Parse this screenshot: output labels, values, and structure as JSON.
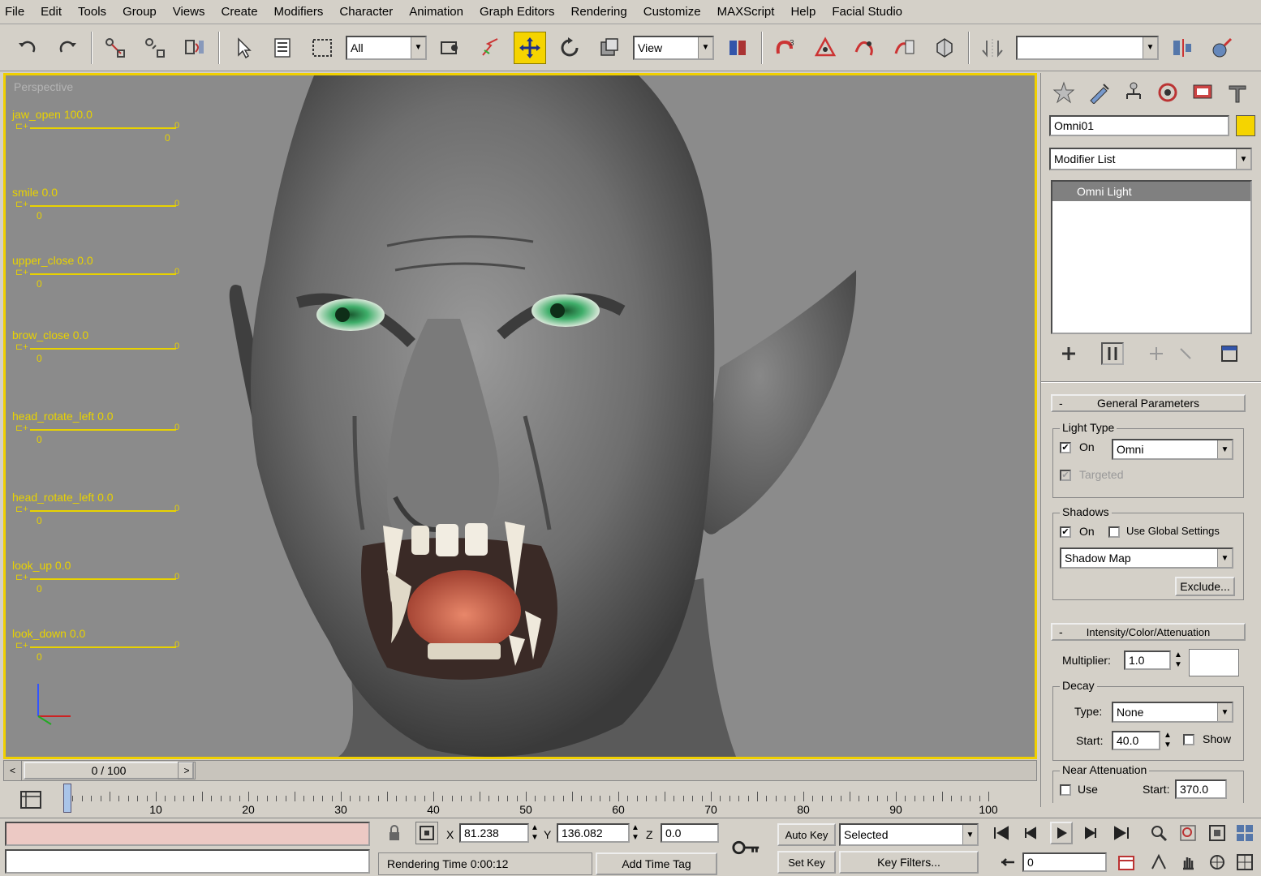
{
  "menu": [
    "File",
    "Edit",
    "Tools",
    "Group",
    "Views",
    "Create",
    "Modifiers",
    "Character",
    "Animation",
    "Graph Editors",
    "Rendering",
    "Customize",
    "MAXScript",
    "Help",
    "Facial Studio"
  ],
  "toolbar": {
    "selection_filter": "All",
    "reference_coord": "View",
    "named_selection": ""
  },
  "viewport": {
    "label": "Perspective",
    "morphs": [
      {
        "name": "jaw_open 100.0",
        "min": "0",
        "max": "0",
        "thumb": "0",
        "value": 1.0
      },
      {
        "name": "smile 0.0",
        "min": "0",
        "max": "0",
        "thumb": "0",
        "value": 0.0
      },
      {
        "name": "upper_close 0.0",
        "min": "0",
        "max": "0",
        "thumb": "0",
        "value": 0.0
      },
      {
        "name": "brow_close 0.0",
        "min": "0",
        "max": "0",
        "thumb": "0",
        "value": 0.0
      },
      {
        "name": "head_rotate_left 0.0",
        "min": "0",
        "max": "0",
        "thumb": "0",
        "value": 0.0
      },
      {
        "name": "head_rotate_left 0.0",
        "min": "0",
        "max": "0",
        "thumb": "0",
        "value": 0.0
      },
      {
        "name": "look_up 0.0",
        "min": "0",
        "max": "0",
        "thumb": "0",
        "value": 0.0
      },
      {
        "name": "look_down 0.0",
        "min": "0",
        "max": "0",
        "thumb": "0",
        "value": 0.0
      }
    ],
    "border_color": "#f0d000",
    "background_color": "#8b8b8b"
  },
  "command_panel": {
    "object_name": "Omni01",
    "object_color": "#f5d400",
    "modifier_list": "Modifier List",
    "stack_item": "Omni Light",
    "general_params": {
      "title": "General Parameters",
      "light_type_group": "Light Type",
      "on_label": "On",
      "on_checked": "✔",
      "light_type": "Omni",
      "targeted_label": "Targeted",
      "targeted_checked": "✔",
      "shadows_group": "Shadows",
      "shadows_on_label": "On",
      "shadows_on_checked": "✔",
      "global_label": "Use Global Settings",
      "shadow_type": "Shadow Map",
      "exclude_label": "Exclude..."
    },
    "intensity": {
      "title": "Intensity/Color/Attenuation",
      "multiplier_label": "Multiplier:",
      "multiplier": "1.0",
      "decay_group": "Decay",
      "type_label": "Type:",
      "type_value": "None",
      "start_label": "Start:",
      "start_value": "40.0",
      "show_label": "Show",
      "near_group": "Near Attenuation",
      "use_label": "Use",
      "near_start_label": "Start:",
      "near_start_value": "370.0"
    }
  },
  "timeline": {
    "slider_text": "0 / 100",
    "frame_labels": [
      "10",
      "20",
      "30",
      "40",
      "50",
      "60",
      "70",
      "80",
      "90",
      "100"
    ]
  },
  "status": {
    "x_label": "X",
    "x_value": "81.238",
    "y_label": "Y",
    "y_value": "136.082",
    "z_label": "Z",
    "z_value": "0.0",
    "render_time": "Rendering Time 0:00:12",
    "add_time_tag": "Add Time Tag",
    "auto_key": "Auto Key",
    "selected": "Selected",
    "set_key": "Set Key",
    "key_filters": "Key Filters...",
    "current_frame": "0"
  }
}
